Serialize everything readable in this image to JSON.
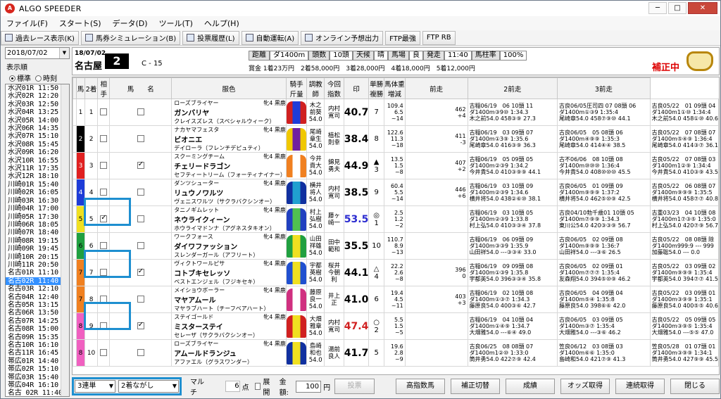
{
  "app": {
    "title": "ALGO SPEEDER"
  },
  "menu": [
    "ファイル(F)",
    "スタート(S)",
    "データ(D)",
    "ツール(T)",
    "ヘルプ(H)"
  ],
  "toolbar": [
    {
      "label": "過去レース表示(K)",
      "icon": "search-icon"
    },
    {
      "label": "馬券シミュレーション(B)",
      "icon": "ticket-icon"
    },
    {
      "label": "投票履歴(L)",
      "icon": "document-icon"
    },
    {
      "label": "自動運転(A)",
      "icon": "gear-icon"
    },
    {
      "label": "オンライン予想出力",
      "icon": "document-icon"
    },
    {
      "label": "FTP最強",
      "icon": ""
    },
    {
      "label": "FTP RB",
      "icon": ""
    }
  ],
  "sidebar": {
    "date": "2018/07/02",
    "display_label": "表示順",
    "radio_standard": "標準",
    "radio_time": "時刻",
    "races": [
      "水沢01R 11:50",
      "水沢02R 12:20",
      "水沢03R 12:50",
      "水沢04R 13:25",
      "水沢05R 14:00",
      "水沢06R 14:35",
      "水沢07R 15:10",
      "水沢08R 15:45",
      "水沢09R 16:20",
      "水沢10R 16:55",
      "水沢11R 17:35",
      "水沢12R 18:10",
      "川崎01R 15:40",
      "川崎02R 16:05",
      "川崎03R 16:30",
      "川崎04R 17:00",
      "川崎05R 17:30",
      "川崎06R 18:05",
      "川崎07R 18:40",
      "川崎08R 19:15",
      "川崎09R 19:45",
      "川崎10R 20:15",
      "川崎11R 20:50",
      "名古01R 11:10",
      "名古02R 11:40",
      "名古03R 12:10",
      "名古04R 12:40",
      "名古05R 13:15",
      "名古06R 13:50",
      "名古07R 14:25",
      "名古08R 15:00",
      "名古09R 15:35",
      "名古10R 16:10",
      "名古11R 16:45",
      "帯広01R 14:40",
      "帯広02R 15:10",
      "帯広03R 15:40",
      "帯広04R 16:10",
      "名古 02R 11:40"
    ],
    "selected_index": 24
  },
  "race": {
    "date": "18/07/02",
    "venue": "名古屋",
    "number": "2",
    "class": "C - 15",
    "info": [
      [
        "距離",
        ""
      ],
      [
        "ダ1400m",
        ""
      ],
      [
        "頭数",
        ""
      ],
      [
        "10頭",
        ""
      ],
      [
        "天候",
        ""
      ],
      [
        "晴",
        ""
      ],
      [
        "馬場",
        ""
      ],
      [
        "良",
        ""
      ],
      [
        "発走",
        ""
      ],
      [
        "11:40",
        ""
      ],
      [
        "馬柱率",
        ""
      ],
      [
        "100%",
        ""
      ]
    ],
    "prize": "賞金 1着23万円　2着58,000円　3着28,000円　4着18,000円　5着12,000円",
    "hosei": "補正中"
  },
  "columns": [
    "馬",
    "2着",
    "相手",
    "馬　　名",
    "服色",
    "騎手\n斤量",
    "調教\n師",
    "今回指数",
    "印",
    "単勝\n複勝",
    "馬体重\n増減",
    "前走",
    "2前走",
    "3前走"
  ],
  "horses": [
    {
      "waku": "1",
      "wcolor": "#ffffff",
      "no": "1",
      "c2": false,
      "aite": false,
      "name": "ガンバリヤ",
      "sire": "ローズブライヤー",
      "dam": "クレイスズレス（スペシャルウィーク）",
      "sex": "牝4 黒鹿",
      "jockey": "木之\n前葵\n54.0",
      "trainer": "内村\n寛司",
      "idx": "40.7",
      "idxc": "",
      "mark": "",
      "rank": "7",
      "odds": "109.4\n6.5\n~14",
      "wt": "462\n+4",
      "p1": [
        "古稲06/19　06 10頭 11",
        "ダ1400m③9⑩ 1:34.3",
        "木之前54.0 458③⑨ 27.3"
      ],
      "p2": [
        "古良06/05圧司四 07 08頭 06",
        "ダ1400m①③9 1:35:4",
        "尾崎章54.0 458⑦⑨⑩ 44.1"
      ],
      "p3": [
        "古良05/22　01 09頭 04",
        "ダ1400m1①⑩ 1:34:4",
        "木之前54.0 458①⑩ 40.6"
      ],
      "s2": "r"
    },
    {
      "waku": "2",
      "wcolor": "#000000",
      "no": "2",
      "c2": false,
      "aite": false,
      "name": "ビオニエ",
      "sire": "ナカヤマフェスタ",
      "dam": "デイローラ（フレンチデピュティ）",
      "sex": "牝4 黒鹿",
      "jockey": "尾崎\n章生\n54.0",
      "trainer": "植松\n則幸",
      "idx": "38.4",
      "idxc": "",
      "mark": "",
      "rank": "8",
      "odds": "122.6\n11.3\n~18",
      "wt": "411\n-3",
      "p1": [
        "古稲06/19　03 09頭 07",
        "ダ1400m①3⑨ 1:35.6",
        "尾崎章54.0 416③⑨ 36.3"
      ],
      "p2": [
        "古良06/05　05 08頭 06",
        "ダ1400m④⑨⑨ 1:35:3",
        "尾崎章54.0 414④④ 38.5"
      ],
      "p3": [
        "古良05/22　07 08頭 07",
        "ダ1400m⑤④⑨ 1:36:4",
        "尾崎章54.0 414③⑦ 36.1"
      ],
      "s2": ""
    },
    {
      "waku": "3",
      "wcolor": "#e02020",
      "no": "3",
      "c2": false,
      "aite": true,
      "name": "チェリードラゴン",
      "sire": "スクーミングチーム",
      "dam": "セフティートリーム（フォーティナイナー）",
      "sex": "牝4 黒鹿",
      "jockey": "今井\n貴大\n54.0",
      "trainer": "錦見\n勇夫",
      "idx": "44.9",
      "idxc": "",
      "mark": "▲",
      "rank": "3",
      "odds": "13.5\n1.5\n~8",
      "wt": "407\n+2",
      "p1": [
        "古稲06/19　05 09頭 05",
        "ダ1400m②③9 1:34.2",
        "今井貴54.0 410③⑨⑨ 44.1"
      ],
      "p2": [
        "古不06/06　08 10頭 08",
        "ダ1400m⑩⑩⑩ 1:36:4",
        "今井貴54.0 408⑩⑩⑩ 45.5"
      ],
      "p3": [
        "古良05/22　07 08頭 03",
        "ダ1400m1②⑨ 1:34:4",
        "今井貴54.0 410③⑨ 43.5"
      ],
      "s2": "r"
    },
    {
      "waku": "4",
      "wcolor": "#1e3cd8",
      "no": "4",
      "c2": false,
      "aite": false,
      "name": "リュウノワルツ",
      "sire": "ダンツシューター",
      "dam": "ヴェニスワルツ（サクラバクシンオー）",
      "sex": "牝4 黒鹿",
      "jockey": "横井\n将人\n54.0",
      "trainer": "内村\n寛司",
      "idx": "38.5",
      "idxc": "",
      "mark": "",
      "rank": "9",
      "odds": "60.4\n5.5\n~14",
      "wt": "446\n+6",
      "p1": [
        "古稲06/19　03 10頭 09",
        "ダ1400m②③9 1:34.6",
        "横井将54.0 438②⑥⑩ 38.1"
      ],
      "p2": [
        "古良06/05　01 09頭 09",
        "ダ1400m⑨⑨⑨ 1:37:2",
        "横井将54.0 462⑤⑩⑨ 42.5"
      ],
      "p3": [
        "古良05/22　06 08頭 07",
        "ダ1400m⑨⑨⑨ 1:35:5",
        "横井将54.0 458⑦⑦ 40.8"
      ],
      "s2": ""
    },
    {
      "waku": "5",
      "wcolor": "#f0e020",
      "no": "5",
      "c2": true,
      "aite": false,
      "name": "ネウライクィーン",
      "sire": "タニノギムレット",
      "dam": "ホウライマドンナ（アグネスタキオン）",
      "sex": "牝4 黒鹿",
      "jockey": "村上\n弘樹\n54.0",
      "trainer": "藤ヶ\n崎一",
      "idx": "53.5",
      "idxc": "b",
      "mark": "◎",
      "rank": "1",
      "odds": "2.5\n1.2\n~2",
      "wt": "",
      "p1": [
        "古稲06/19　03 10頭 05",
        "ダ1400m②③9 1:33.8",
        "村上弘54.0 410③③④ 37.8"
      ],
      "p2": [
        "古良04/10勃千歳01 10頭 05",
        "ダ1400m⑦⑨⑨ 1:34.3",
        "東川公54.0 420③③⑨ 56.7"
      ],
      "p3": [
        "古重03/23　04 10頭 08",
        "ダ1400m1⑦③⑤ 1:35:0",
        "村上弘54.0 420⑦⑨ 56.7"
      ],
      "s2": "b"
    },
    {
      "waku": "6",
      "wcolor": "#20a040",
      "no": "6",
      "c2": false,
      "aite": false,
      "name": "ダイワファッション",
      "sire": "ワークフォース",
      "dam": "スレンダーガール（アフリート）",
      "sex": "牝4 黒鹿",
      "jockey": "山田\n祥雄\n54.0",
      "trainer": "田中\n範和",
      "idx": "35.5",
      "idxc": "",
      "mark": "",
      "rank": "10",
      "odds": "110.7\n8.9\n~13",
      "wt": "",
      "p1": [
        "古稲06/19　06 09頭 09",
        "ダ1400m③③9 1:35.9",
        "山田祥54.0 ---③③④ 33.0"
      ],
      "p2": [
        "古良06/05　02 09頭 08",
        "ダ1400m⑨⑨⑨ 1:36:7",
        "山田祥54.0 ---③⑥ 26.5"
      ],
      "p3": [
        "古良05/22　08 08頭 除",
        "ダ1400m999:9 --- 999",
        "加藤聡54.0 --- 0.0"
      ],
      "s2": ""
    },
    {
      "waku": "7",
      "wcolor": "#f08020",
      "no": "7",
      "c2": false,
      "aite": true,
      "name": "コトブキセレッソ",
      "sire": "ヴィクトワールピサ",
      "dam": "ペストエンジェル（フジキセキ）",
      "sex": "牝4 黒鹿",
      "jockey": "宇都\n英樹\n54.0",
      "trainer": "桜井\n今朝\n利",
      "idx": "44.1",
      "idxc": "",
      "mark": "△",
      "rank": "4",
      "odds": "22.2\n2.6\n~8",
      "wt": "396\n0",
      "p1": [
        "古稲06/19　09 09頭 08",
        "ダ1400m①③9 1:35.8",
        "宇都英54.0 396③③④ 35.8"
      ],
      "p2": [
        "古良06/05　02 09頭 01",
        "ダ1400m⑦⑦⑦ 1:35:4",
        "友森翔54.0 394⑤⑩⑨ 46.2"
      ],
      "p3": [
        "古良05/22　03 09頭 02",
        "ダ1400m⑨⑨⑨ 1:35:4",
        "宇都英54.0 394⑦⑦ 41.5"
      ],
      "s2": "r"
    },
    {
      "waku": "7",
      "wcolor": "#f08020",
      "no": "8",
      "c2": false,
      "aite": false,
      "name": "マヤアムール",
      "sire": "メイショウボーラー",
      "dam": "マヤラブハート（チーフベアハート）",
      "sex": "牝4 黒鹿",
      "jockey": "藤原\n良一\n54.0",
      "trainer": "井上\n正",
      "idx": "41.0",
      "idxc": "",
      "mark": "",
      "rank": "6",
      "odds": "19.4\n4.5\n~11",
      "wt": "403\n+3",
      "p1": [
        "古稲06/19　02 10頭 08",
        "ダ1400m①③⑦ 1:34.3",
        "藤原良54.0 400③⑥ 42.7"
      ],
      "p2": [
        "古良06/05　04 09頭 04",
        "ダ1400m⑤④ 1:35:8",
        "藤原良54.0 398⑥⑥ 42.0"
      ],
      "p3": [
        "古良05/22　03 09頭 01",
        "ダ1400m③⑨⑨ 1:35:1",
        "藤原良54.0 400⑤⑤ 40.6"
      ],
      "s2": ""
    },
    {
      "waku": "8",
      "wcolor": "#f060c0",
      "no": "9",
      "c2": false,
      "aite": true,
      "name": "ミスターステイ",
      "sire": "ステイゴールド",
      "dam": "セレーザ（サクラバクシンオー）",
      "sex": "牝4 黒鹿",
      "jockey": "大畑\n雅章\n54.0",
      "trainer": "内村\n寛司",
      "idx": "47.4",
      "idxc": "r",
      "mark": "○",
      "rank": "2",
      "odds": "5.5\n1.5\n~5",
      "wt": "",
      "p1": [
        "古稲06/19　04 10頭 04",
        "ダ1400m①④⑨ 1:34.7",
        "大畑雅54.0 ---⑥④ 49.0"
      ],
      "p2": [
        "古良06/05　03 09頭 05",
        "ダ1400m③⑦ 1:35:4",
        "大畑雅54.0 ---③⑥ 46.2"
      ],
      "p3": [
        "古良05/22　05 09頭 05",
        "ダ1400m③⑨⑤ 1:35:4",
        "大畑雅54.0 ---⑤⑤ 47.0"
      ],
      "s2": "r"
    },
    {
      "waku": "8",
      "wcolor": "#f060c0",
      "no": "10",
      "c2": false,
      "aite": false,
      "name": "アムールドランジュ",
      "sire": "ローズブライヤー",
      "dam": "アファエル（グラスワンダー）",
      "sex": "牝4 黒鹿",
      "jockey": "島崎\n和也\n54.0",
      "trainer": "湯前\n良人",
      "idx": "41.7",
      "idxc": "",
      "mark": "",
      "rank": "5",
      "odds": "19.6\n2.8\n~9",
      "wt": "",
      "p1": [
        "古良06/25　08 08頭 07",
        "ダ1400m1②⑩ 1:33:0",
        "筒井勇54.0 422⑦⑨ 42.4"
      ],
      "p2": [
        "笠良06/12　03 08頭 03",
        "ダ1400m⑥⑥ 1:35:0",
        "島崎和54.0 421⑦⑨ 41.3"
      ],
      "p3": [
        "笠良05/28　01 07頭 01",
        "ダ1400m③⑨⑨ 1:34:1",
        "筒井勇54.0 427⑨⑨ 45.5"
      ],
      "s2": "r3"
    }
  ],
  "bottom": {
    "bet_type": "3連単",
    "bet_mode": "2着ながし",
    "multi": "マルチ",
    "points": "6",
    "points_unit": "点",
    "tenkai": "展開",
    "amount_label": "金額:",
    "amount": "100",
    "amount_unit": "円",
    "vote": "投票",
    "buttons": [
      "高指数馬",
      "補正切替",
      "成績",
      "オッズ取得",
      "連続取得",
      "閉じる"
    ]
  },
  "colors": {
    "accent": "#1e8fd0",
    "hosei": "#dd0000",
    "selection": "#3390ff"
  }
}
